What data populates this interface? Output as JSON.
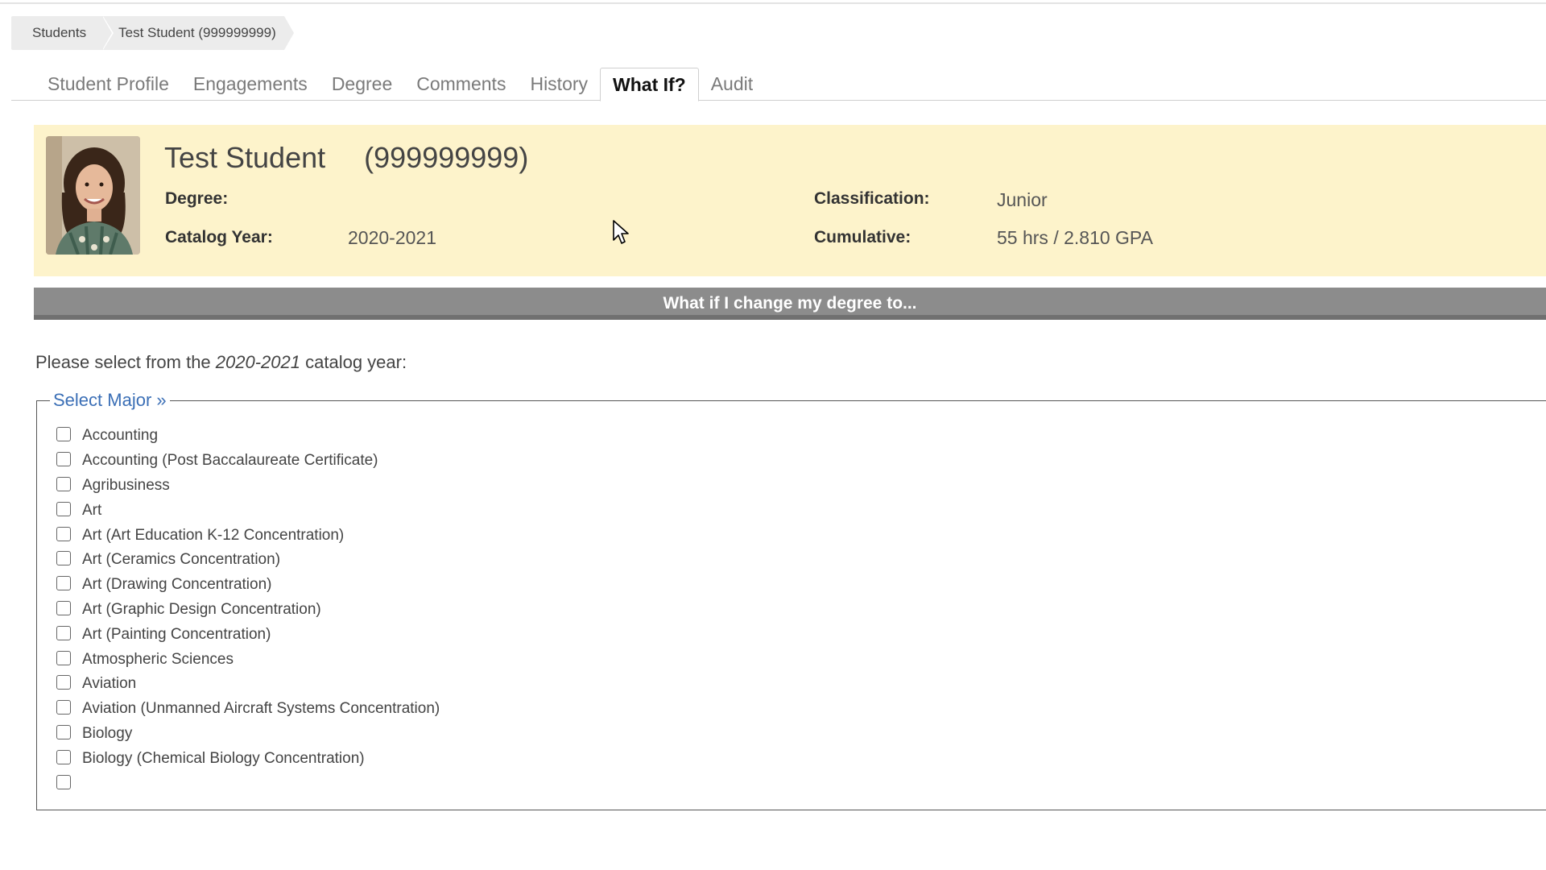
{
  "breadcrumb": {
    "items": [
      "Students",
      "Test Student (999999999)"
    ]
  },
  "tabs": [
    {
      "label": "Student Profile",
      "active": false
    },
    {
      "label": "Engagements",
      "active": false
    },
    {
      "label": "Degree",
      "active": false
    },
    {
      "label": "Comments",
      "active": false
    },
    {
      "label": "History",
      "active": false
    },
    {
      "label": "What If?",
      "active": true
    },
    {
      "label": "Audit",
      "active": false
    }
  ],
  "profile": {
    "name": "Test Student",
    "id": "(999999999)",
    "degree_label": "Degree:",
    "degree_value": "",
    "catalog_year_label": "Catalog Year:",
    "catalog_year_value": "2020-2021",
    "classification_label": "Classification:",
    "classification_value": "Junior",
    "cumulative_label": "Cumulative:",
    "cumulative_value": "55 hrs / 2.810 GPA",
    "panel_color": "#fdf3cb"
  },
  "whatif": {
    "header": "What if I change my degree to...",
    "instruction_prefix": "Please select from the ",
    "instruction_year": "2020-2021",
    "instruction_suffix": " catalog year:",
    "select_major_label": "Select Major »"
  },
  "majors": [
    "Accounting",
    "Accounting (Post Baccalaureate Certificate)",
    "Agribusiness",
    "Art",
    "Art (Art Education K-12 Concentration)",
    "Art (Ceramics Concentration)",
    "Art (Drawing Concentration)",
    "Art (Graphic Design Concentration)",
    "Art (Painting Concentration)",
    "Atmospheric Sciences",
    "Aviation",
    "Aviation (Unmanned Aircraft Systems Concentration)",
    "Biology",
    "Biology (Chemical Biology Concentration)"
  ],
  "colors": {
    "link": "#3b6fb6",
    "header_bar": "#8c8c8c"
  }
}
